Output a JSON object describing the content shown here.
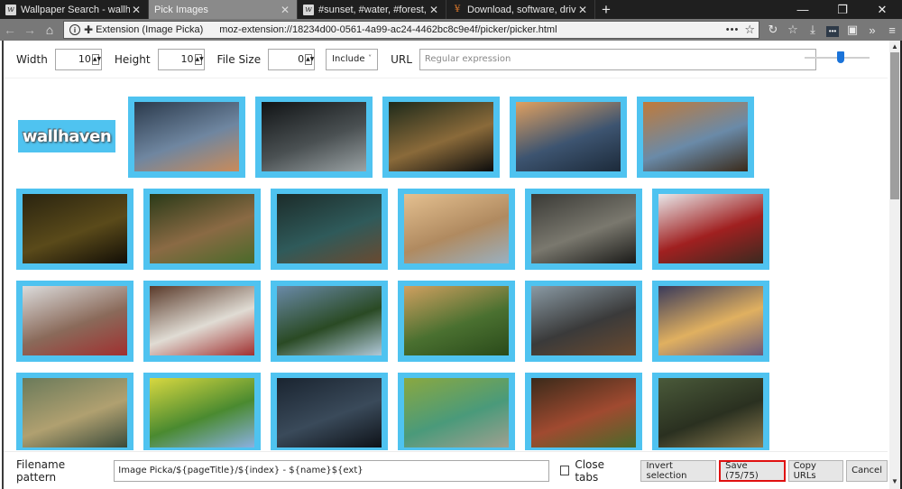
{
  "browser": {
    "tabs": [
      {
        "title": "Wallpaper Search - wallhaven.c",
        "favicon": "wallhaven-icon",
        "active": false
      },
      {
        "title": "Pick Images",
        "favicon": "",
        "active": true
      },
      {
        "title": "#sunset, #water, #forest, #mist",
        "favicon": "wallhaven-icon",
        "active": false
      },
      {
        "title": "Download, software, drivers, ga",
        "favicon": "download-site-icon",
        "active": false
      }
    ],
    "new_tab_label": "+",
    "window_controls": {
      "minimize": "—",
      "restore": "❐",
      "close": "✕"
    },
    "nav": {
      "back": "←",
      "forward": "→",
      "home": "⌂"
    },
    "urlbar": {
      "info": "i",
      "extension_label": "Extension (Image Picka)",
      "url": "moz-extension://18234d00-0561-4a99-ac24-4462bc8c9e4f/picker/picker.html",
      "more": "•••",
      "star": "☆"
    },
    "toolbar_icons": {
      "reload": "↻",
      "library": "☆",
      "download": "⤓",
      "extension_dots": "•••",
      "picka": "▣",
      "overflow": "»",
      "menu": "≡"
    }
  },
  "filters": {
    "width_label": "Width",
    "width_value": "10",
    "height_label": "Height",
    "height_value": "10",
    "filesize_label": "File Size",
    "filesize_value": "0",
    "mode_selected": "Include",
    "url_label": "URL",
    "url_placeholder": "Regular expression",
    "zoom_slider_fraction": 0.55
  },
  "grid": {
    "logo_text": "wallhaven",
    "selected_color": "#4fc3f0",
    "images": [
      {
        "name": "car-mirror-sunset",
        "c": [
          "#2b3a4c",
          "#6f86a0",
          "#c98b5a"
        ]
      },
      {
        "name": "forest-woman-wolf",
        "c": [
          "#111416",
          "#4a5052",
          "#9aa2a4"
        ]
      },
      {
        "name": "black-car-forest",
        "c": [
          "#1e2a1a",
          "#8a6a3a",
          "#0c0c0c"
        ]
      },
      {
        "name": "ocean-rocks-sunset",
        "c": [
          "#e0a060",
          "#3d5470",
          "#1c2a3a"
        ]
      },
      {
        "name": "lake-mountain-reflection",
        "c": [
          "#c07a3a",
          "#6a8aa8",
          "#3a2a1a"
        ]
      },
      {
        "name": "dark-forest",
        "c": [
          "#2a2410",
          "#5a4a1a",
          "#120e06"
        ]
      },
      {
        "name": "mushroom-stack",
        "c": [
          "#2a3a18",
          "#8a6a44",
          "#4a6a2a"
        ]
      },
      {
        "name": "aerial-river-forest",
        "c": [
          "#1c2c2a",
          "#2f5a5a",
          "#6a4a30"
        ]
      },
      {
        "name": "misty-lake-trees",
        "c": [
          "#e4c090",
          "#b08a60",
          "#9ab0c0"
        ]
      },
      {
        "name": "foggy-forest-structure",
        "c": [
          "#3a3a36",
          "#7a786e",
          "#1a1a18"
        ]
      },
      {
        "name": "girl-white-hood-red",
        "c": [
          "#e8e8ea",
          "#a02020",
          "#3a2a20"
        ]
      },
      {
        "name": "girl-fur-hood-closeup",
        "c": [
          "#dcdcdc",
          "#8a6a5a",
          "#a03030"
        ]
      },
      {
        "name": "girl-fur-hood-winter",
        "c": [
          "#5a3a2a",
          "#e0dcd4",
          "#a03030"
        ]
      },
      {
        "name": "mountain-valley-green",
        "c": [
          "#6a8aa8",
          "#2a4a24",
          "#b0c8d8"
        ]
      },
      {
        "name": "green-hills-sunset",
        "c": [
          "#d0a060",
          "#4a7030",
          "#2a4a1a"
        ]
      },
      {
        "name": "misty-pine-path",
        "c": [
          "#8a9aa4",
          "#3a3a3a",
          "#6a4a30"
        ]
      },
      {
        "name": "fantasy-forest-knight",
        "c": [
          "#3a3a5a",
          "#e0b060",
          "#6a5a7a"
        ]
      },
      {
        "name": "cottage-sunbeams",
        "c": [
          "#6a7a5a",
          "#b0a070",
          "#3a4a3a"
        ]
      },
      {
        "name": "anime-wolf-meadow",
        "c": [
          "#d8d840",
          "#4a8a30",
          "#8ab0e0"
        ]
      },
      {
        "name": "dark-cabin-night",
        "c": [
          "#1a2430",
          "#3a4a5a",
          "#0e1218"
        ]
      },
      {
        "name": "waterfall-green-pool",
        "c": [
          "#8aa840",
          "#4a9a7a",
          "#a0a090"
        ]
      },
      {
        "name": "redwood-road",
        "c": [
          "#3a2a1a",
          "#a04a30",
          "#4a6a2a"
        ]
      },
      {
        "name": "treehouse-forest",
        "c": [
          "#4a5a3a",
          "#2a3020",
          "#8a7a50"
        ]
      }
    ]
  },
  "footer": {
    "filename_label": "Filename pattern",
    "filename_value": "Image Picka/${pageTitle}/${index} - ${name}${ext}",
    "close_tabs_label": "Close tabs",
    "close_tabs_checked": false,
    "invert_label": "Invert selection",
    "save_label": "Save (75/75)",
    "copy_label": "Copy URLs",
    "cancel_label": "Cancel"
  },
  "scrollbar": {
    "up": "▲",
    "down": "▼",
    "position_fraction": 0
  }
}
